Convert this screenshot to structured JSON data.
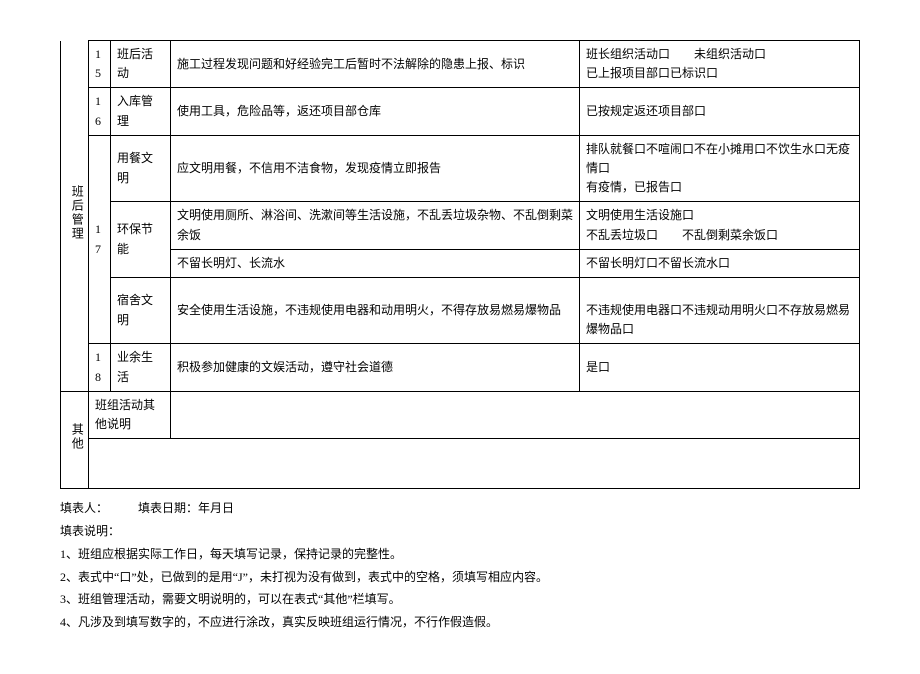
{
  "rows": {
    "r15": {
      "num": "15",
      "item": "班后活动",
      "desc": "施工过程发现问题和好经验完工后暂时不法解除的隐患上报、标识",
      "check": "班长组织活动口　　未组织活动口\n已上报项目部口已标识口"
    },
    "r16": {
      "num": "16",
      "item": "入库管理",
      "desc": "使用工具，危险品等，返还项目部仓库",
      "check": "已按规定返还项目部口"
    },
    "r17_a": {
      "item": "用餐文明",
      "desc": "应文明用餐，不信用不洁食物，发现疫情立即报告",
      "check": "排队就餐口不喧闹口不在小摊用口不饮生水口无疫情口\n有疫情，已报告口"
    },
    "r17_b": {
      "num": "17",
      "item": "环保节能",
      "desc_1": "文明使用厕所、淋浴间、洗漱间等生活设施，不乱丢垃圾杂物、不乱倒剩菜余饭",
      "check_1": "文明使用生活设施口\n不乱丢垃圾口　　不乱倒剩菜余饭口",
      "desc_2": "不留长明灯、长流水",
      "check_2": "不留长明灯口不留长流水口"
    },
    "r17_c": {
      "item": "宿舍文明",
      "desc": "安全使用生活设施，不违规使用电器和动用明火，不得存放易燃易爆物品",
      "check": "\n不违规使用电器口不违规动用明火口不存放易燃易爆物品口"
    },
    "r18": {
      "num": "18",
      "item": "业余生活",
      "desc": "积极参加健康的文娱活动，遵守社会道德",
      "check": "是口"
    },
    "other_label": "班组活动其他说明",
    "cat_after": "班后管理",
    "cat_other": "其他"
  },
  "footer": {
    "line1": "填表人：　　　填表日期：年月日",
    "line2": "填表说明：",
    "note1": "1、班组应根据实际工作日，每天填写记录，保持记录的完整性。",
    "note2": "2、表式中“口”处，已做到的是用“J”，未打视为没有做到，表式中的空格，须填写相应内容。",
    "note3": "3、班组管理活动，需要文明说明的，可以在表式“其他”栏填写。",
    "note4": "4、凡涉及到填写数字的，不应进行涂改，真实反映班组运行情况，不行作假造假。"
  }
}
